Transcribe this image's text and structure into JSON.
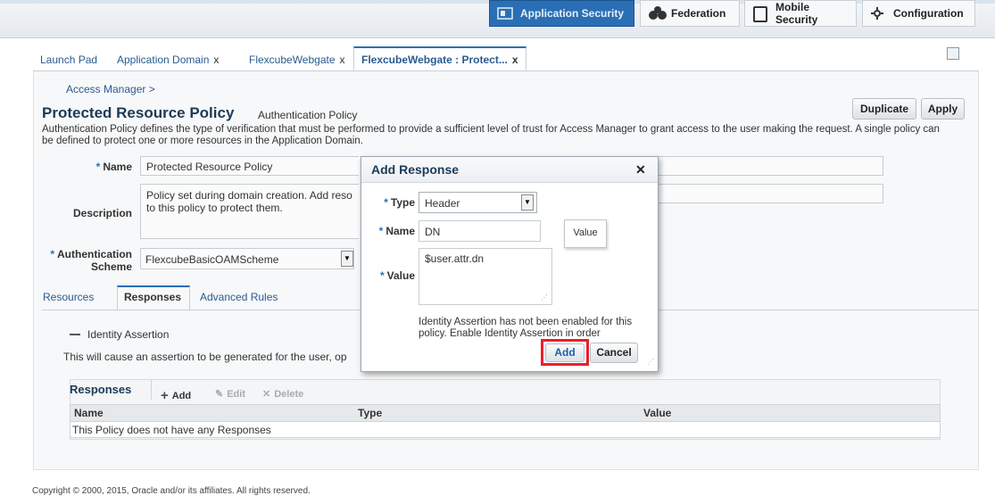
{
  "topnav": {
    "items": [
      {
        "label": "Application Security",
        "icon": "application-security-icon",
        "active": true
      },
      {
        "label": "Federation",
        "icon": "federation-icon",
        "active": false
      },
      {
        "label": "Mobile Security",
        "icon": "mobile-security-icon",
        "active": false
      },
      {
        "label": "Configuration",
        "icon": "gear-icon",
        "active": false
      }
    ]
  },
  "tabs": [
    {
      "label": "Launch Pad",
      "closable": false
    },
    {
      "label": "Application Domain",
      "closable": true
    },
    {
      "label": "FlexcubeWebgate",
      "closable": true
    },
    {
      "label": "FlexcubeWebgate : Protect...",
      "closable": true,
      "active": true
    }
  ],
  "tab_close_glyph": "x",
  "breadcrumb": "Access Manager >",
  "page": {
    "title": "Protected Resource Policy",
    "subtitle": "Authentication Policy",
    "description": "Authentication Policy defines the type of verification that must be performed to provide a sufficient level of trust for Access Manager to grant access to the user making the request. A single policy can be defined to protect one or more resources in the Application Domain.",
    "duplicate_label": "Duplicate",
    "apply_label": "Apply"
  },
  "form": {
    "name_label": "Name",
    "name_value": "Protected Resource Policy",
    "description_label": "Description",
    "description_value": "Policy set during domain creation. Add reso to this policy to protect them.",
    "auth_scheme_label_1": "Authentication",
    "auth_scheme_label_2": "Scheme",
    "auth_scheme_value": "FlexcubeBasicOAMScheme",
    "required_mark": "*"
  },
  "subtabs": [
    "Resources",
    "Responses",
    "Advanced Rules"
  ],
  "identity_assertion": {
    "label": "Identity Assertion",
    "text": "This will cause an assertion to be generated for the user, op"
  },
  "responses": {
    "title": "Responses",
    "add_label": "Add",
    "edit_label": "Edit",
    "delete_label": "Delete",
    "columns": [
      "Name",
      "Type",
      "Value"
    ],
    "empty_text": "This Policy does not have any Responses"
  },
  "dialog": {
    "title": "Add Response",
    "close_glyph": "✕",
    "type_label": "Type",
    "type_value": "Header",
    "name_label": "Name",
    "name_value": "DN",
    "value_label": "Value",
    "value_value": "$user.attr.dn",
    "tooltip": "Value",
    "note": "Identity Assertion has not been enabled for this policy. Enable Identity Assertion in order",
    "add_label": "Add",
    "cancel_label": "Cancel"
  },
  "footer": "Copyright © 2000, 2015, Oracle and/or its affiliates. All rights reserved.",
  "colors": {
    "accent": "#2a6fb5",
    "highlight": "#e8202a",
    "title": "#1c3a57"
  }
}
